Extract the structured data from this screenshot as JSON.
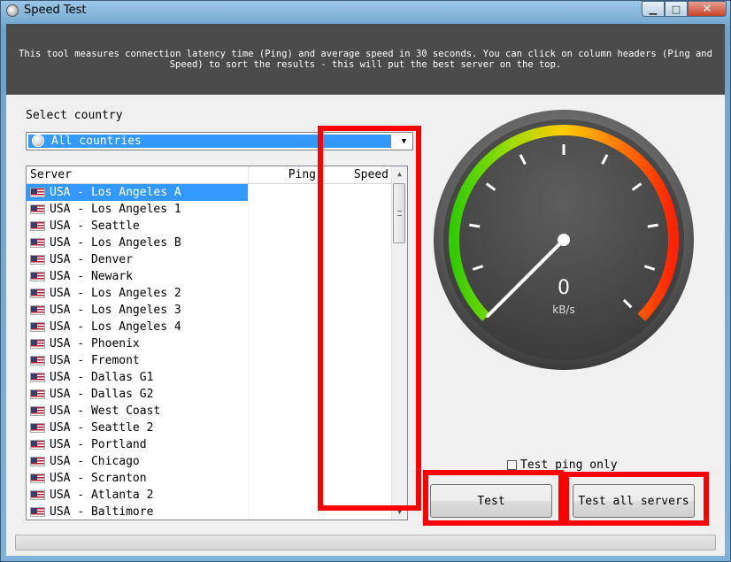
{
  "window": {
    "title": "Speed Test",
    "controls": {
      "minimize": "▁",
      "maximize": "□",
      "close": "✕"
    }
  },
  "header": {
    "description": "This tool measures connection latency time (Ping) and average speed in 30 seconds. You can click on column headers (Ping and Speed) to sort the results - this will put the best server on the top."
  },
  "country": {
    "label": "Select country",
    "selected": "All countries",
    "icon": "globe-icon"
  },
  "list": {
    "columns": {
      "server": "Server",
      "ping": "Ping",
      "speed": "Speed"
    },
    "rows": [
      {
        "server": "USA - Los Angeles A",
        "ping": "",
        "speed": "",
        "selected": true
      },
      {
        "server": "USA - Los Angeles 1",
        "ping": "",
        "speed": ""
      },
      {
        "server": "USA - Seattle",
        "ping": "",
        "speed": ""
      },
      {
        "server": "USA - Los Angeles B",
        "ping": "",
        "speed": ""
      },
      {
        "server": "USA - Denver",
        "ping": "",
        "speed": ""
      },
      {
        "server": "USA - Newark",
        "ping": "",
        "speed": ""
      },
      {
        "server": "USA - Los Angeles 2",
        "ping": "",
        "speed": ""
      },
      {
        "server": "USA - Los Angeles 3",
        "ping": "",
        "speed": ""
      },
      {
        "server": "USA - Los Angeles 4",
        "ping": "",
        "speed": ""
      },
      {
        "server": "USA - Phoenix",
        "ping": "",
        "speed": ""
      },
      {
        "server": "USA - Fremont",
        "ping": "",
        "speed": ""
      },
      {
        "server": "USA - Dallas G1",
        "ping": "",
        "speed": ""
      },
      {
        "server": "USA - Dallas G2",
        "ping": "",
        "speed": ""
      },
      {
        "server": "USA - West Coast",
        "ping": "",
        "speed": ""
      },
      {
        "server": "USA - Seattle 2",
        "ping": "",
        "speed": ""
      },
      {
        "server": "USA - Portland",
        "ping": "",
        "speed": ""
      },
      {
        "server": "USA - Chicago",
        "ping": "",
        "speed": ""
      },
      {
        "server": "USA - Scranton",
        "ping": "",
        "speed": ""
      },
      {
        "server": "USA - Atlanta 2",
        "ping": "",
        "speed": ""
      },
      {
        "server": "USA - Baltimore",
        "ping": "",
        "speed": ""
      }
    ]
  },
  "gauge": {
    "value": "0",
    "unit": "kB/s",
    "colors": {
      "low": "#33cc00",
      "mid": "#ffcc00",
      "high": "#ff3300",
      "face": "#4a4a4a"
    }
  },
  "controls": {
    "ping_only_label": "Test ping only",
    "ping_only_checked": false,
    "test_button": "Test",
    "test_all_button": "Test all servers"
  },
  "annotation": {
    "highlight_color": "#ff0000"
  }
}
